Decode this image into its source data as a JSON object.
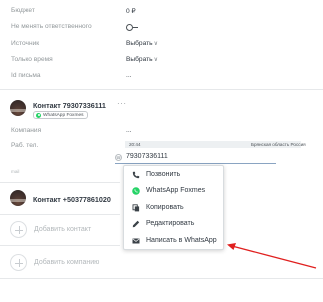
{
  "fields": {
    "budget_label": "Бюджет",
    "budget_value": "0 ₽",
    "no_change_resp_label": "Не менять ответственного",
    "source_label": "Источник",
    "source_value": "Выбрать",
    "only_time_label": "Только время",
    "only_time_value": "Выбрать",
    "letter_id_label": "Id письма",
    "letter_id_value": "..."
  },
  "contact1": {
    "name": "Контакт 79307336111",
    "more": "···",
    "whatsapp_badge": "WhatsApp Foxmes",
    "company_label": "Компания",
    "company_value": "...",
    "phone_label": "Раб. тел.",
    "phone_time": "20:44",
    "phone_region": "Брянская область Россия",
    "phone_value": "79307336111",
    "mail_label": "mail"
  },
  "menu": {
    "items": [
      {
        "label": "Позвонить",
        "icon": "phone-icon"
      },
      {
        "label": "WhatsApp Foxmes",
        "icon": "whatsapp-icon"
      },
      {
        "label": "Копировать",
        "icon": "copy-icon"
      },
      {
        "label": "Редактировать",
        "icon": "pencil-icon"
      },
      {
        "label": "Написать в WhatsApp",
        "icon": "envelope-icon"
      }
    ]
  },
  "contact2": {
    "name": "Контакт +50377861020"
  },
  "add": {
    "contact_label": "Добавить контакт",
    "company_label": "Добавить компанию"
  },
  "colors": {
    "accent": "#25d366",
    "annotation_arrow": "#e0201f"
  }
}
